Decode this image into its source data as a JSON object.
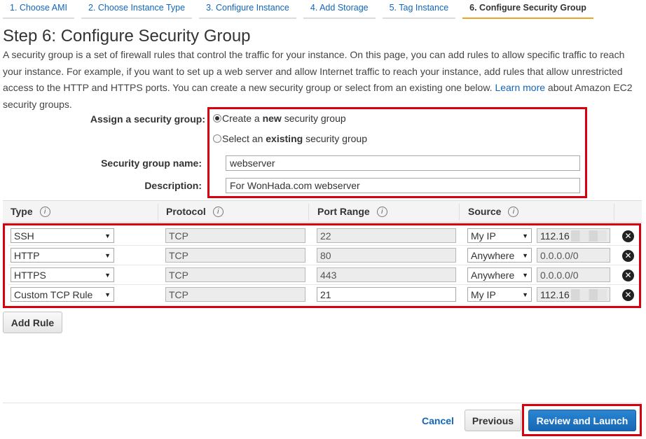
{
  "wizard": {
    "tabs": [
      {
        "label": "1. Choose AMI"
      },
      {
        "label": "2. Choose Instance Type"
      },
      {
        "label": "3. Configure Instance"
      },
      {
        "label": "4. Add Storage"
      },
      {
        "label": "5. Tag Instance"
      },
      {
        "label": "6. Configure Security Group"
      }
    ],
    "active_tab": "6. Configure Security Group"
  },
  "page": {
    "title": "Step 6: Configure Security Group",
    "intro_text": "A security group is a set of firewall rules that control the traffic for your instance. On this page, you can add rules to allow specific traffic to reach your instance. For example, if you want to set up a web server and allow Internet traffic to reach your instance, add rules that allow unrestricted access to the HTTP and HTTPS ports. You can create a new security group or select from an existing one below.",
    "learn_more": "Learn more",
    "intro_suffix": "about Amazon EC2 security groups."
  },
  "assign": {
    "label": "Assign a security group:",
    "option_new_prefix": "Create a",
    "option_new_bold": "new",
    "option_new_suffix": "security group",
    "option_existing_prefix": "Select an",
    "option_existing_bold": "existing",
    "option_existing_suffix": "security group",
    "selected": "new",
    "name_label": "Security group name:",
    "name_value": "webserver",
    "description_label": "Description:",
    "description_value": "For WonHada.com webserver"
  },
  "table": {
    "headers": {
      "type": "Type",
      "protocol": "Protocol",
      "port_range": "Port Range",
      "source": "Source"
    },
    "info_glyph": "i",
    "rows": [
      {
        "type": "SSH",
        "protocol": "TCP",
        "port": "22",
        "port_editable": false,
        "source": "My IP",
        "cidr": "112.16"
      },
      {
        "type": "HTTP",
        "protocol": "TCP",
        "port": "80",
        "port_editable": false,
        "source": "Anywhere",
        "cidr": "0.0.0.0/0"
      },
      {
        "type": "HTTPS",
        "protocol": "TCP",
        "port": "443",
        "port_editable": false,
        "source": "Anywhere",
        "cidr": "0.0.0.0/0"
      },
      {
        "type": "Custom TCP Rule",
        "protocol": "TCP",
        "port": "21",
        "port_editable": true,
        "source": "My IP",
        "cidr": "112.16"
      }
    ],
    "remove_glyph": "✕"
  },
  "actions": {
    "add_rule": "Add Rule",
    "cancel": "Cancel",
    "previous": "Previous",
    "review_launch": "Review and Launch"
  },
  "colors": {
    "link": "#1166bb",
    "highlight": "#d9000d",
    "primary_button": "#1767b3",
    "active_tab_underline": "#f0a32a"
  }
}
